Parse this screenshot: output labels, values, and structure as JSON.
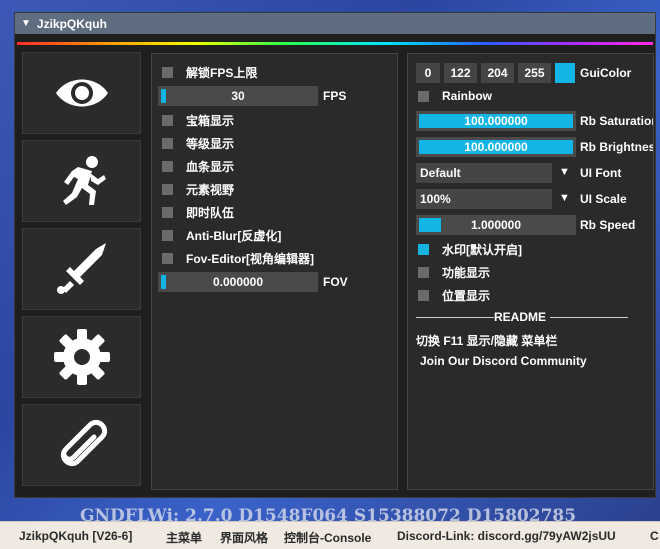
{
  "window": {
    "title": "JzikpQKquh"
  },
  "background_text": "GNDFLWi: 2.7.0 D1548F064 S15388072 D15802785",
  "sidebar": {
    "tabs": [
      {
        "name": "eye-icon"
      },
      {
        "name": "running-person-icon"
      },
      {
        "name": "sword-icon"
      },
      {
        "name": "gear-icon"
      },
      {
        "name": "paperclip-icon"
      }
    ]
  },
  "left_panel": {
    "unlock_fps": "解锁FPS上限",
    "fps_value": "30",
    "fps_label": "FPS",
    "fps_fraction": 0.02,
    "chest": "宝箱显示",
    "level": "等级显示",
    "health": "血条显示",
    "element": "元素视野",
    "team": "即时队伍",
    "anti_blur": "Anti-Blur[反虚化]",
    "fov_editor": "Fov-Editor[视角编辑器]",
    "fov_value": "0.000000",
    "fov_label": "FOV",
    "fov_fraction": 0.02
  },
  "right_panel": {
    "rgb": [
      "0",
      "122",
      "204",
      "255"
    ],
    "gui_color_label": "GuiColor",
    "accent_color": "#12b5e6",
    "rainbow": "Rainbow",
    "rb_saturation_value": "100.000000",
    "rb_saturation_label": "Rb Saturation",
    "rb_brightness_value": "100.000000",
    "rb_brightness_label": "Rb Brightness",
    "ui_font_value": "Default",
    "ui_font_label": "UI Font",
    "ui_scale_value": "100%",
    "ui_scale_label": "UI Scale",
    "rb_speed_value": "1.000000",
    "rb_speed_label": "Rb Speed",
    "rb_speed_fraction": 0.15,
    "watermark": "水印[默认开启]",
    "feature_display": "功能显示",
    "position_display": "位置显示",
    "readme_title": "README",
    "readme_toggle": "切换 F11 显示/隐藏 菜单栏",
    "readme_discord": "Join Our Discord Community"
  },
  "taskbar": {
    "app": "JzikpQKquh [V26-6]",
    "main_menu": "主菜单",
    "style": "界面风格",
    "console": "控制台-Console",
    "discord": "Discord-Link: discord.gg/79yAW2jsUU",
    "tail": "C"
  }
}
